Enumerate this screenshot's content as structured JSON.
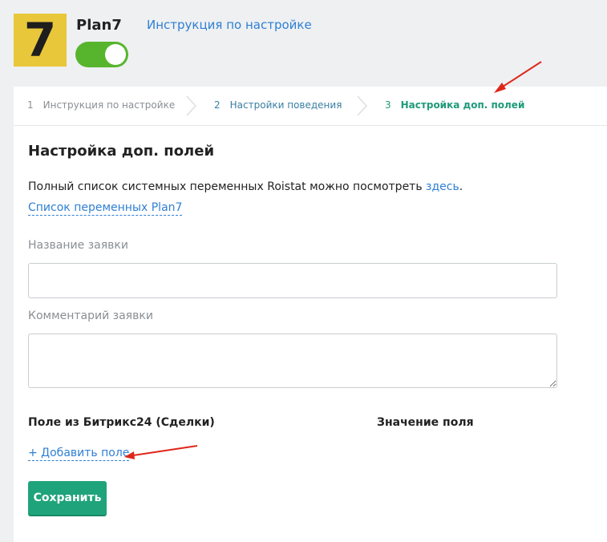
{
  "app": {
    "logo_text": "7",
    "name": "Plan7",
    "toggle_enabled": true,
    "instructions_link": "Инструкция по настройке"
  },
  "steps": [
    {
      "number": "1",
      "label": "Инструкция по настройке",
      "state": "done"
    },
    {
      "number": "2",
      "label": "Настройки поведения",
      "state": "done"
    },
    {
      "number": "3",
      "label": "Настройка доп. полей",
      "state": "active"
    }
  ],
  "main": {
    "title": "Настройка доп. полей",
    "info_text": "Полный список системных переменных Roistat можно посмотреть ",
    "info_link": "здесь",
    "info_end": ".",
    "vars_link": "Список переменных Plan7",
    "fields": [
      {
        "label": "Название заявки",
        "value": ""
      },
      {
        "label": "Комментарий заявки",
        "value": ""
      }
    ],
    "columns": {
      "field_from": "Поле из Битрикс24 (Сделки)",
      "field_value": "Значение поля"
    },
    "add_field": "+ Добавить поле",
    "save_button": "Сохранить"
  },
  "colors": {
    "accent_green": "#1fa37a",
    "link_blue": "#2f7fd3",
    "toggle_green": "#57b52d",
    "logo_yellow": "#e8c73a",
    "annotation_red": "#e0261b"
  }
}
